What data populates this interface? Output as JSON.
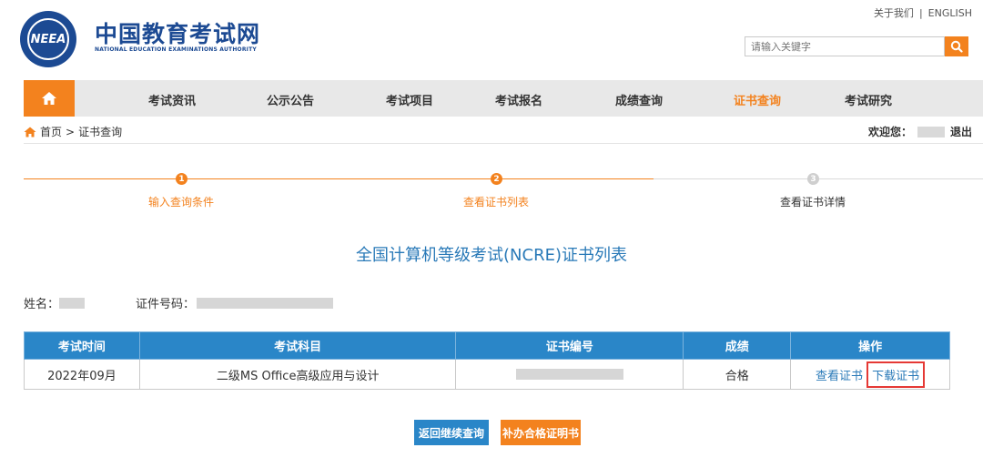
{
  "header": {
    "logo_text": "NEEA",
    "title": "中国教育考试网",
    "subtitle": "NATIONAL EDUCATION EXAMINATIONS AUTHORITY",
    "about": "关于我们",
    "separator": "|",
    "english": "ENGLISH",
    "search_placeholder": "请输入关键字"
  },
  "nav": {
    "items": [
      "考试资讯",
      "公示公告",
      "考试项目",
      "考试报名",
      "成绩查询",
      "证书查询",
      "考试研究"
    ],
    "active_index": 5
  },
  "breadcrumb": {
    "home": "首页",
    "separator": ">",
    "current": "证书查询"
  },
  "welcome": {
    "label": "欢迎您：",
    "logout": "退出"
  },
  "steps": [
    {
      "number": "1",
      "label": "输入查询条件",
      "state": "done"
    },
    {
      "number": "2",
      "label": "查看证书列表",
      "state": "current"
    },
    {
      "number": "3",
      "label": "查看证书详情",
      "state": "todo"
    }
  ],
  "page_title": "全国计算机等级考试(NCRE)证书列表",
  "info": {
    "name_label": "姓名：",
    "id_label": "证件号码："
  },
  "table": {
    "headers": [
      "考试时间",
      "考试科目",
      "证书编号",
      "成绩",
      "操作"
    ],
    "rows": [
      {
        "time": "2022年09月",
        "subject": "二级MS Office高级应用与设计",
        "score": "合格",
        "view": "查看证书",
        "download": "下载证书"
      }
    ]
  },
  "buttons": {
    "back": "返回继续查询",
    "reissue": "补办合格证明书"
  },
  "colors": {
    "brand_blue": "#1c4a93",
    "accent_orange": "#f3821e",
    "table_header": "#2a86c8",
    "link_blue": "#2a7ab8",
    "highlight_red": "#e53935"
  }
}
